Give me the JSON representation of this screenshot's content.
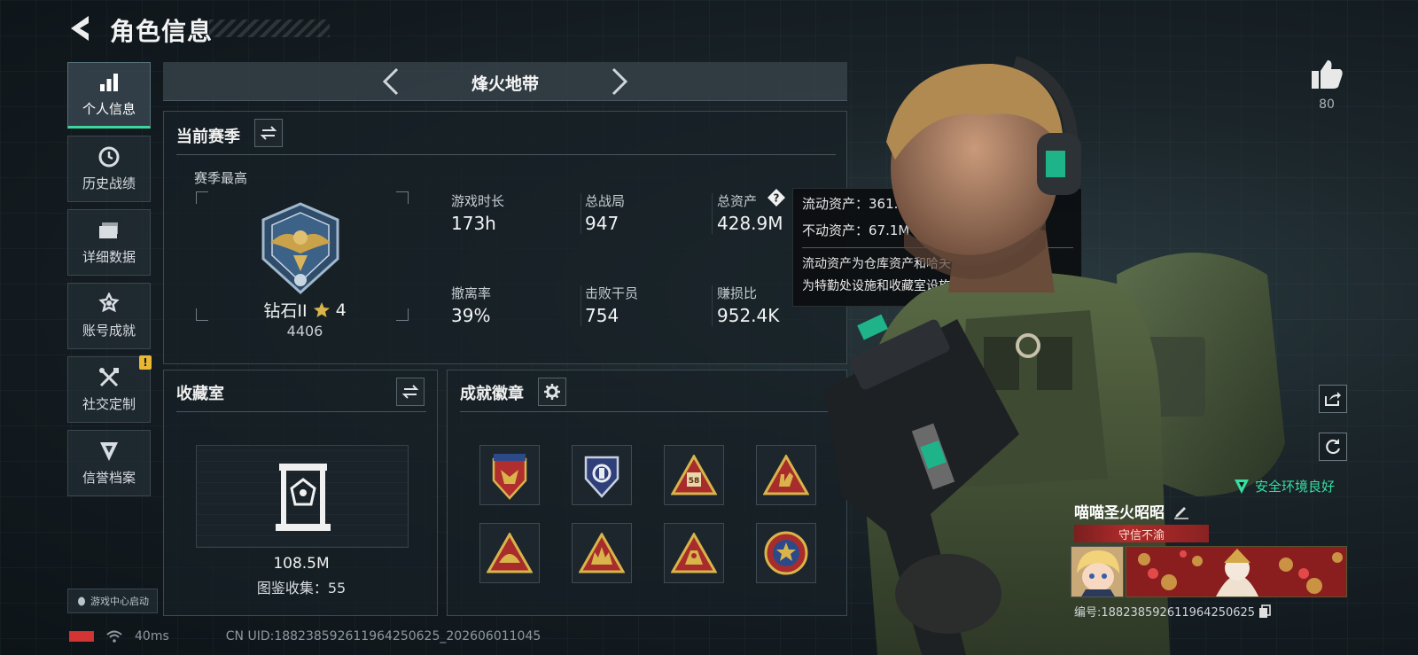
{
  "header": {
    "title": "角色信息"
  },
  "sidebar": {
    "items": [
      {
        "label": "个人信息",
        "icon": "bar-chart-icon",
        "active": true
      },
      {
        "label": "历史战绩",
        "icon": "clock-icon"
      },
      {
        "label": "详细数据",
        "icon": "folder-icon"
      },
      {
        "label": "账号成就",
        "icon": "achievement-icon"
      },
      {
        "label": "社交定制",
        "icon": "tools-icon",
        "badge": "!"
      },
      {
        "label": "信誉档案",
        "icon": "shield-icon"
      }
    ],
    "game_center_label": "游戏中心启动"
  },
  "mode": {
    "title": "烽火地带"
  },
  "season": {
    "title": "当前赛季",
    "subtitle": "赛季最高",
    "rank_name": "钻石II",
    "rank_stars": "4",
    "rank_score": "4406",
    "stats": [
      {
        "label": "游戏时长",
        "value": "173h"
      },
      {
        "label": "总战局",
        "value": "947"
      },
      {
        "label": "总资产",
        "value": "428.9M"
      },
      {
        "label": "撤离率",
        "value": "39%"
      },
      {
        "label": "击败干员",
        "value": "754"
      },
      {
        "label": "赚损比",
        "value": "952.4K"
      }
    ]
  },
  "tooltip": {
    "liquid": "流动资产：361.8M",
    "fixed": "不动资产：67.1M",
    "desc_line1": "流动资产为仓库资产和哈夫币，不动资产",
    "desc_line2": "为特勤处设施和收藏室设施"
  },
  "collection": {
    "title": "收藏室",
    "value": "108.5M",
    "catalog": "图鉴收集：55"
  },
  "badges": {
    "title": "成就徽章",
    "items": [
      "badge-shield-eagle",
      "badge-police",
      "badge-triangle-58",
      "badge-triangle-hand",
      "badge-triangle-helmet",
      "badge-triangle-deer",
      "badge-triangle-hand2",
      "badge-star-round"
    ]
  },
  "profile": {
    "likes": "80",
    "env_status": "安全环境良好",
    "player_name": "喵喵圣火昭昭",
    "title_tag": "守信不渝",
    "player_code": "编号:18823859261196425062​5"
  },
  "status_bar": {
    "ping": "40ms",
    "uid": "CN UID:18823859261196425062​5_202606011045"
  },
  "colors": {
    "accent": "#3dd6a0",
    "warn": "#e8b832",
    "battery": "#d43434"
  }
}
